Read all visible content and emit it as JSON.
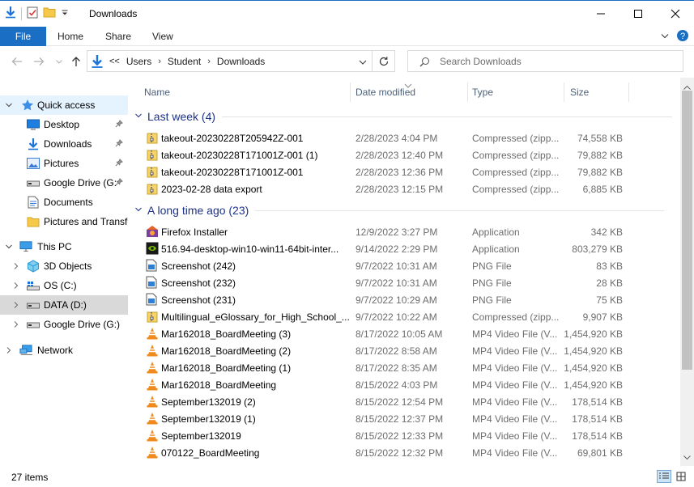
{
  "window": {
    "title": "Downloads"
  },
  "ribbon": {
    "tabs": [
      {
        "label": "File"
      },
      {
        "label": "Home"
      },
      {
        "label": "Share"
      },
      {
        "label": "View"
      }
    ]
  },
  "address": {
    "prefix": "<<",
    "crumbs": [
      "Users",
      "Student",
      "Downloads"
    ]
  },
  "search": {
    "placeholder": "Search Downloads"
  },
  "nav": {
    "items": [
      {
        "label": "Quick access",
        "icon": "star-icon",
        "level": 0,
        "expanded": true,
        "selected": true
      },
      {
        "label": "Desktop",
        "icon": "desktop-icon",
        "level": 1,
        "pinned": true
      },
      {
        "label": "Downloads",
        "icon": "download-arrow-icon",
        "level": 1,
        "pinned": true
      },
      {
        "label": "Pictures",
        "icon": "pictures-icon",
        "level": 1,
        "pinned": true
      },
      {
        "label": "Google Drive (G:",
        "icon": "drive-icon",
        "level": 1,
        "pinned": true
      },
      {
        "label": "Documents",
        "icon": "documents-icon",
        "level": 1
      },
      {
        "label": "Pictures and Transfe",
        "icon": "folder-icon",
        "level": 1
      },
      {
        "label": "This PC",
        "icon": "computer-icon",
        "level": 0,
        "expanded": true
      },
      {
        "label": "3D Objects",
        "icon": "cube-icon",
        "level": 1,
        "collapsed": true
      },
      {
        "label": "OS (C:)",
        "icon": "os-drive-icon",
        "level": 1,
        "collapsed": true
      },
      {
        "label": "DATA (D:)",
        "icon": "drive-icon",
        "level": 1,
        "collapsed": true,
        "hover": true
      },
      {
        "label": "Google Drive (G:)",
        "icon": "drive-icon",
        "level": 1,
        "collapsed": true
      },
      {
        "label": "Network",
        "icon": "network-icon",
        "level": 0,
        "collapsed": true
      }
    ]
  },
  "columns": {
    "name": "Name",
    "date": "Date modified",
    "type": "Type",
    "size": "Size"
  },
  "groups": [
    {
      "label": "Last week (4)",
      "files": [
        {
          "name": "takeout-20230228T205942Z-001",
          "date": "2/28/2023 4:04 PM",
          "type": "Compressed (zipp...",
          "size": "74,558 KB",
          "icon": "zip-icon"
        },
        {
          "name": "takeout-20230228T171001Z-001 (1)",
          "date": "2/28/2023 12:40 PM",
          "type": "Compressed (zipp...",
          "size": "79,882 KB",
          "icon": "zip-icon"
        },
        {
          "name": "takeout-20230228T171001Z-001",
          "date": "2/28/2023 12:36 PM",
          "type": "Compressed (zipp...",
          "size": "79,882 KB",
          "icon": "zip-icon"
        },
        {
          "name": "2023-02-28 data export",
          "date": "2/28/2023 12:15 PM",
          "type": "Compressed (zipp...",
          "size": "6,885 KB",
          "icon": "zip-icon"
        }
      ]
    },
    {
      "label": "A long time ago (23)",
      "files": [
        {
          "name": "Firefox Installer",
          "date": "12/9/2022 3:27 PM",
          "type": "Application",
          "size": "342 KB",
          "icon": "firefox-installer-icon"
        },
        {
          "name": "516.94-desktop-win10-win11-64bit-inter...",
          "date": "9/14/2022 2:29 PM",
          "type": "Application",
          "size": "803,279 KB",
          "icon": "nvidia-icon"
        },
        {
          "name": "Screenshot (242)",
          "date": "9/7/2022 10:31 AM",
          "type": "PNG File",
          "size": "83 KB",
          "icon": "image-file-icon"
        },
        {
          "name": "Screenshot (232)",
          "date": "9/7/2022 10:31 AM",
          "type": "PNG File",
          "size": "28 KB",
          "icon": "image-file-icon"
        },
        {
          "name": "Screenshot (231)",
          "date": "9/7/2022 10:29 AM",
          "type": "PNG File",
          "size": "75 KB",
          "icon": "image-file-icon"
        },
        {
          "name": "Multilingual_eGlossary_for_High_School_...",
          "date": "9/7/2022 10:22 AM",
          "type": "Compressed (zipp...",
          "size": "9,907 KB",
          "icon": "zip-icon"
        },
        {
          "name": "Mar162018_BoardMeeting (3)",
          "date": "8/17/2022 10:05 AM",
          "type": "MP4 Video File (V...",
          "size": "1,454,920 KB",
          "icon": "vlc-cone-icon"
        },
        {
          "name": "Mar162018_BoardMeeting (2)",
          "date": "8/17/2022 8:58 AM",
          "type": "MP4 Video File (V...",
          "size": "1,454,920 KB",
          "icon": "vlc-cone-icon"
        },
        {
          "name": "Mar162018_BoardMeeting (1)",
          "date": "8/17/2022 8:35 AM",
          "type": "MP4 Video File (V...",
          "size": "1,454,920 KB",
          "icon": "vlc-cone-icon"
        },
        {
          "name": "Mar162018_BoardMeeting",
          "date": "8/15/2022 4:03 PM",
          "type": "MP4 Video File (V...",
          "size": "1,454,920 KB",
          "icon": "vlc-cone-icon"
        },
        {
          "name": "September132019 (2)",
          "date": "8/15/2022 12:54 PM",
          "type": "MP4 Video File (V...",
          "size": "178,514 KB",
          "icon": "vlc-cone-icon"
        },
        {
          "name": "September132019 (1)",
          "date": "8/15/2022 12:37 PM",
          "type": "MP4 Video File (V...",
          "size": "178,514 KB",
          "icon": "vlc-cone-icon"
        },
        {
          "name": "September132019",
          "date": "8/15/2022 12:33 PM",
          "type": "MP4 Video File (V...",
          "size": "178,514 KB",
          "icon": "vlc-cone-icon"
        },
        {
          "name": "070122_BoardMeeting",
          "date": "8/15/2022 12:32 PM",
          "type": "MP4 Video File (V...",
          "size": "69,801 KB",
          "icon": "vlc-cone-icon"
        }
      ]
    }
  ],
  "status": {
    "count": "27 items"
  },
  "colors": {
    "accent": "#1a6fc4",
    "group_heading": "#1e3287",
    "selected": "#e5f3ff"
  }
}
